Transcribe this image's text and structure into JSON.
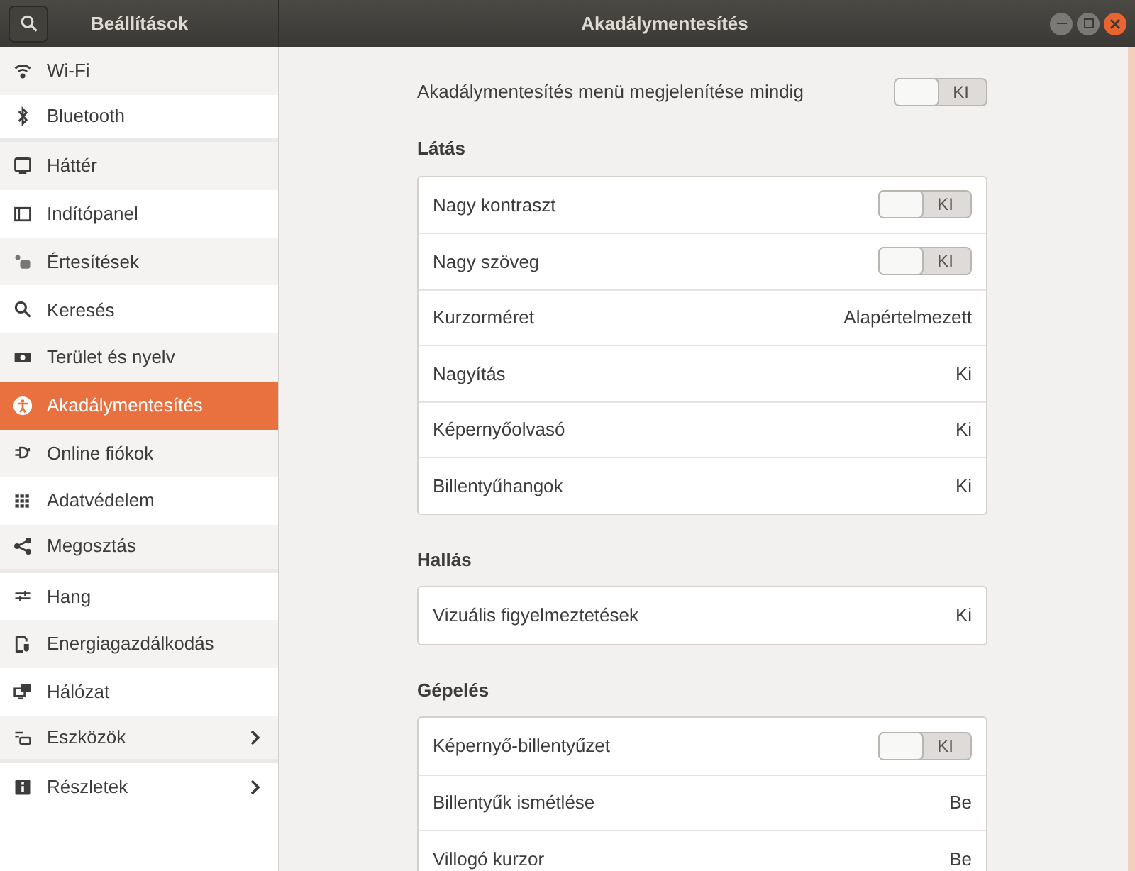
{
  "header": {
    "sidebar_title": "Beállítások",
    "window_title": "Akadálymentesítés"
  },
  "sidebar": {
    "items": [
      {
        "label": "Wi-Fi",
        "selected": false,
        "has_submenu": false,
        "group_end": false
      },
      {
        "label": "Bluetooth",
        "selected": false,
        "has_submenu": false,
        "group_end": true
      },
      {
        "label": "Háttér",
        "selected": false,
        "has_submenu": false,
        "group_end": false
      },
      {
        "label": "Indítópanel",
        "selected": false,
        "has_submenu": false,
        "group_end": false
      },
      {
        "label": "Értesítések",
        "selected": false,
        "has_submenu": false,
        "group_end": false
      },
      {
        "label": "Keresés",
        "selected": false,
        "has_submenu": false,
        "group_end": false
      },
      {
        "label": "Terület és nyelv",
        "selected": false,
        "has_submenu": false,
        "group_end": false
      },
      {
        "label": "Akadálymentesítés",
        "selected": true,
        "has_submenu": false,
        "group_end": false
      },
      {
        "label": "Online fiókok",
        "selected": false,
        "has_submenu": false,
        "group_end": false
      },
      {
        "label": "Adatvédelem",
        "selected": false,
        "has_submenu": false,
        "group_end": false
      },
      {
        "label": "Megosztás",
        "selected": false,
        "has_submenu": false,
        "group_end": true
      },
      {
        "label": "Hang",
        "selected": false,
        "has_submenu": false,
        "group_end": false
      },
      {
        "label": "Energiagazdálkodás",
        "selected": false,
        "has_submenu": false,
        "group_end": false
      },
      {
        "label": "Hálózat",
        "selected": false,
        "has_submenu": false,
        "group_end": false
      },
      {
        "label": "Eszközök",
        "selected": false,
        "has_submenu": true,
        "group_end": true
      },
      {
        "label": "Részletek",
        "selected": false,
        "has_submenu": true,
        "group_end": false
      }
    ]
  },
  "top_option": {
    "label": "Akadálymentesítés menü megjelenítése mindig",
    "on": false,
    "state_label": "KI"
  },
  "sections": [
    {
      "title": "Látás",
      "rows": [
        {
          "kind": "switch",
          "label": "Nagy kontraszt",
          "on": false,
          "state_label": "KI"
        },
        {
          "kind": "switch",
          "label": "Nagy szöveg",
          "on": false,
          "state_label": "KI"
        },
        {
          "kind": "value",
          "label": "Kurzorméret",
          "value": "Alapértelmezett"
        },
        {
          "kind": "value",
          "label": "Nagyítás",
          "value": "Ki"
        },
        {
          "kind": "value",
          "label": "Képernyőolvasó",
          "value": "Ki"
        },
        {
          "kind": "value",
          "label": "Billentyűhangok",
          "value": "Ki"
        }
      ]
    },
    {
      "title": "Hallás",
      "rows": [
        {
          "kind": "value",
          "label": "Vizuális figyelmeztetések",
          "value": "Ki"
        }
      ]
    },
    {
      "title": "Gépelés",
      "rows": [
        {
          "kind": "switch",
          "label": "Képernyő-billentyűzet",
          "on": false,
          "state_label": "KI"
        },
        {
          "kind": "value",
          "label": "Billentyűk ismétlése",
          "value": "Be"
        },
        {
          "kind": "value",
          "label": "Villogó kurzor",
          "value": "Be"
        }
      ]
    }
  ]
}
